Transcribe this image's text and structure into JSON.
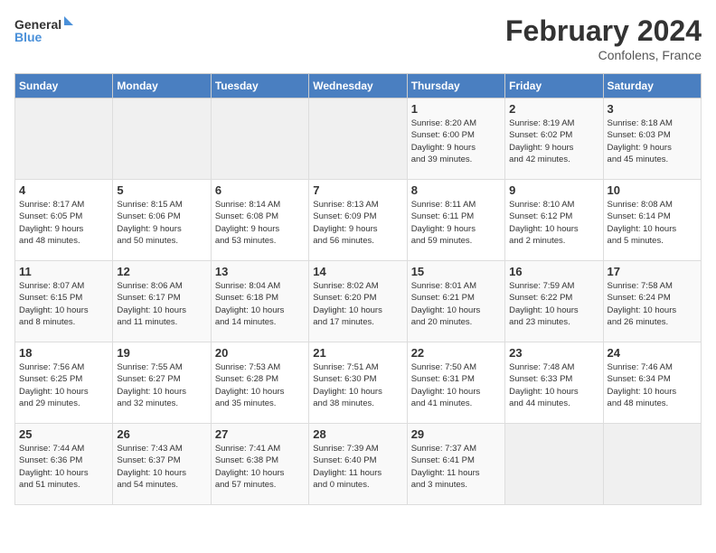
{
  "header": {
    "logo_line1": "General",
    "logo_line2": "Blue",
    "month": "February 2024",
    "location": "Confolens, France"
  },
  "days_of_week": [
    "Sunday",
    "Monday",
    "Tuesday",
    "Wednesday",
    "Thursday",
    "Friday",
    "Saturday"
  ],
  "weeks": [
    [
      {
        "day": "",
        "info": ""
      },
      {
        "day": "",
        "info": ""
      },
      {
        "day": "",
        "info": ""
      },
      {
        "day": "",
        "info": ""
      },
      {
        "day": "1",
        "info": "Sunrise: 8:20 AM\nSunset: 6:00 PM\nDaylight: 9 hours\nand 39 minutes."
      },
      {
        "day": "2",
        "info": "Sunrise: 8:19 AM\nSunset: 6:02 PM\nDaylight: 9 hours\nand 42 minutes."
      },
      {
        "day": "3",
        "info": "Sunrise: 8:18 AM\nSunset: 6:03 PM\nDaylight: 9 hours\nand 45 minutes."
      }
    ],
    [
      {
        "day": "4",
        "info": "Sunrise: 8:17 AM\nSunset: 6:05 PM\nDaylight: 9 hours\nand 48 minutes."
      },
      {
        "day": "5",
        "info": "Sunrise: 8:15 AM\nSunset: 6:06 PM\nDaylight: 9 hours\nand 50 minutes."
      },
      {
        "day": "6",
        "info": "Sunrise: 8:14 AM\nSunset: 6:08 PM\nDaylight: 9 hours\nand 53 minutes."
      },
      {
        "day": "7",
        "info": "Sunrise: 8:13 AM\nSunset: 6:09 PM\nDaylight: 9 hours\nand 56 minutes."
      },
      {
        "day": "8",
        "info": "Sunrise: 8:11 AM\nSunset: 6:11 PM\nDaylight: 9 hours\nand 59 minutes."
      },
      {
        "day": "9",
        "info": "Sunrise: 8:10 AM\nSunset: 6:12 PM\nDaylight: 10 hours\nand 2 minutes."
      },
      {
        "day": "10",
        "info": "Sunrise: 8:08 AM\nSunset: 6:14 PM\nDaylight: 10 hours\nand 5 minutes."
      }
    ],
    [
      {
        "day": "11",
        "info": "Sunrise: 8:07 AM\nSunset: 6:15 PM\nDaylight: 10 hours\nand 8 minutes."
      },
      {
        "day": "12",
        "info": "Sunrise: 8:06 AM\nSunset: 6:17 PM\nDaylight: 10 hours\nand 11 minutes."
      },
      {
        "day": "13",
        "info": "Sunrise: 8:04 AM\nSunset: 6:18 PM\nDaylight: 10 hours\nand 14 minutes."
      },
      {
        "day": "14",
        "info": "Sunrise: 8:02 AM\nSunset: 6:20 PM\nDaylight: 10 hours\nand 17 minutes."
      },
      {
        "day": "15",
        "info": "Sunrise: 8:01 AM\nSunset: 6:21 PM\nDaylight: 10 hours\nand 20 minutes."
      },
      {
        "day": "16",
        "info": "Sunrise: 7:59 AM\nSunset: 6:22 PM\nDaylight: 10 hours\nand 23 minutes."
      },
      {
        "day": "17",
        "info": "Sunrise: 7:58 AM\nSunset: 6:24 PM\nDaylight: 10 hours\nand 26 minutes."
      }
    ],
    [
      {
        "day": "18",
        "info": "Sunrise: 7:56 AM\nSunset: 6:25 PM\nDaylight: 10 hours\nand 29 minutes."
      },
      {
        "day": "19",
        "info": "Sunrise: 7:55 AM\nSunset: 6:27 PM\nDaylight: 10 hours\nand 32 minutes."
      },
      {
        "day": "20",
        "info": "Sunrise: 7:53 AM\nSunset: 6:28 PM\nDaylight: 10 hours\nand 35 minutes."
      },
      {
        "day": "21",
        "info": "Sunrise: 7:51 AM\nSunset: 6:30 PM\nDaylight: 10 hours\nand 38 minutes."
      },
      {
        "day": "22",
        "info": "Sunrise: 7:50 AM\nSunset: 6:31 PM\nDaylight: 10 hours\nand 41 minutes."
      },
      {
        "day": "23",
        "info": "Sunrise: 7:48 AM\nSunset: 6:33 PM\nDaylight: 10 hours\nand 44 minutes."
      },
      {
        "day": "24",
        "info": "Sunrise: 7:46 AM\nSunset: 6:34 PM\nDaylight: 10 hours\nand 48 minutes."
      }
    ],
    [
      {
        "day": "25",
        "info": "Sunrise: 7:44 AM\nSunset: 6:36 PM\nDaylight: 10 hours\nand 51 minutes."
      },
      {
        "day": "26",
        "info": "Sunrise: 7:43 AM\nSunset: 6:37 PM\nDaylight: 10 hours\nand 54 minutes."
      },
      {
        "day": "27",
        "info": "Sunrise: 7:41 AM\nSunset: 6:38 PM\nDaylight: 10 hours\nand 57 minutes."
      },
      {
        "day": "28",
        "info": "Sunrise: 7:39 AM\nSunset: 6:40 PM\nDaylight: 11 hours\nand 0 minutes."
      },
      {
        "day": "29",
        "info": "Sunrise: 7:37 AM\nSunset: 6:41 PM\nDaylight: 11 hours\nand 3 minutes."
      },
      {
        "day": "",
        "info": ""
      },
      {
        "day": "",
        "info": ""
      }
    ]
  ]
}
